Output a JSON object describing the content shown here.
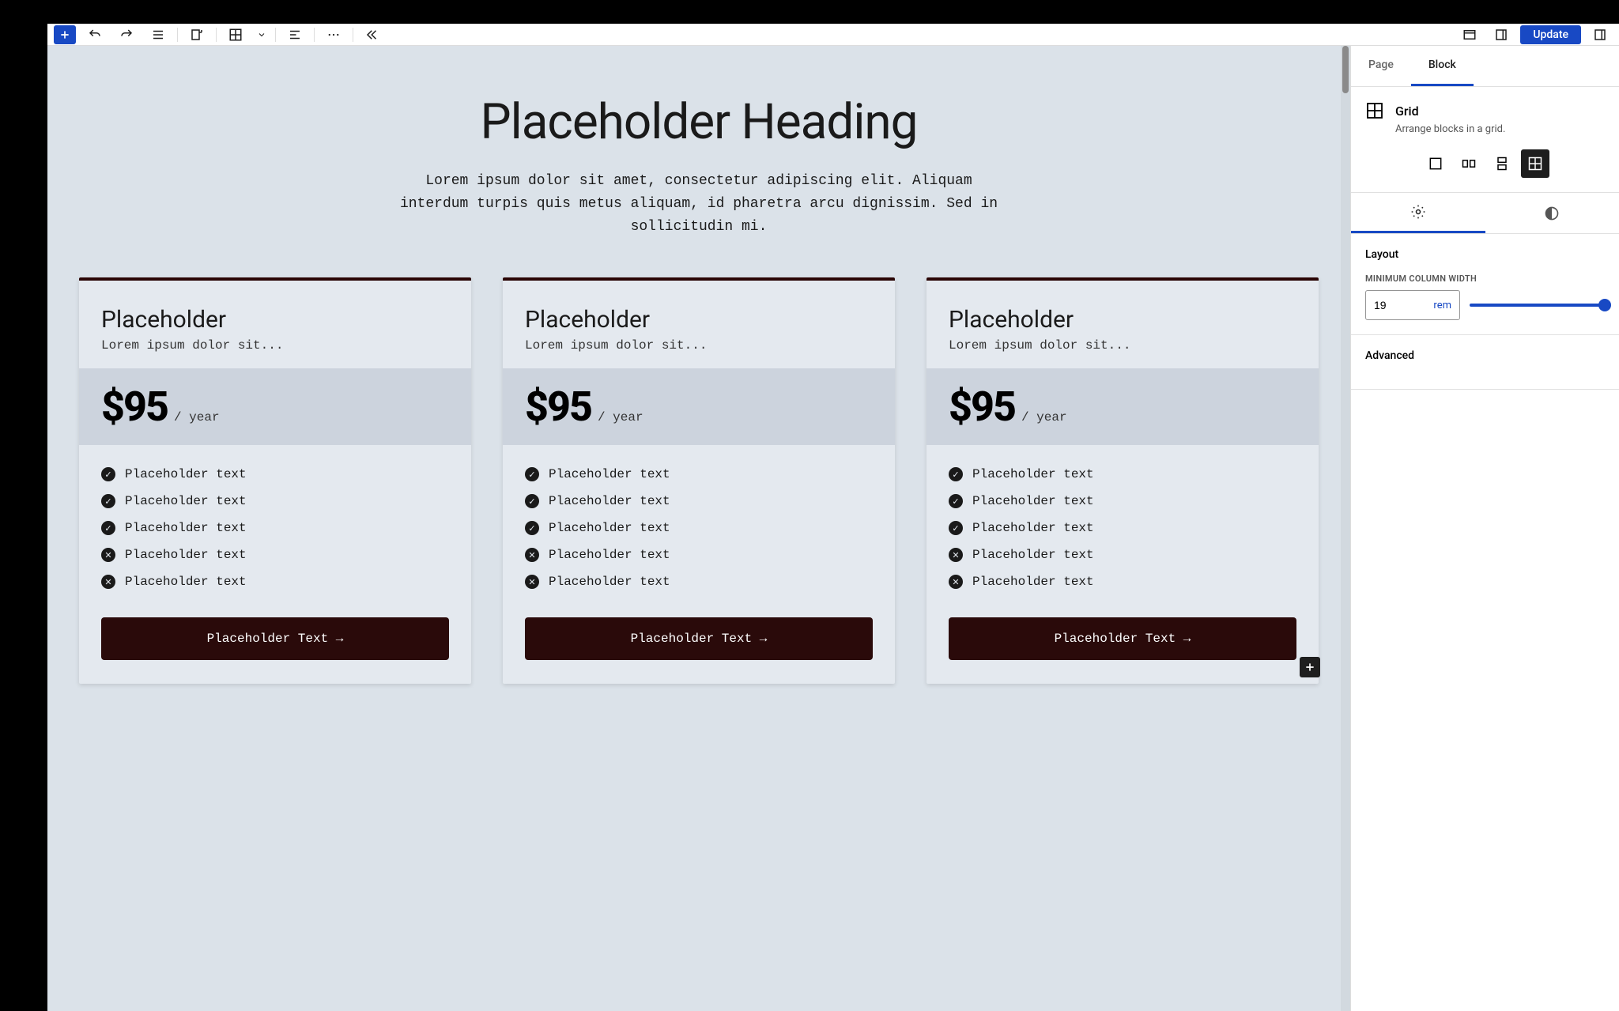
{
  "toolbar": {
    "update_label": "Update"
  },
  "sidebar": {
    "tabs": {
      "page": "Page",
      "block": "Block"
    },
    "block": {
      "name": "Grid",
      "description": "Arrange blocks in a grid."
    },
    "layout": {
      "title": "Layout",
      "min_col_width_label": "Minimum Column Width",
      "min_col_width_value": "19",
      "min_col_width_unit": "rem"
    },
    "advanced": {
      "title": "Advanced"
    }
  },
  "content": {
    "heading": "Placeholder Heading",
    "subheading": "Lorem ipsum dolor sit amet, consectetur adipiscing elit. Aliquam interdum turpis quis metus aliquam, id pharetra arcu dignissim. Sed in sollicitudin mi.",
    "cards": [
      {
        "title": "Placeholder",
        "subtitle": "Lorem ipsum dolor sit...",
        "price": "$95",
        "period": "/ year",
        "features": [
          {
            "ok": true,
            "text": "Placeholder text"
          },
          {
            "ok": true,
            "text": "Placeholder text"
          },
          {
            "ok": true,
            "text": "Placeholder text"
          },
          {
            "ok": false,
            "text": "Placeholder text"
          },
          {
            "ok": false,
            "text": "Placeholder text"
          }
        ],
        "cta": "Placeholder Text →"
      },
      {
        "title": "Placeholder",
        "subtitle": "Lorem ipsum dolor sit...",
        "price": "$95",
        "period": "/ year",
        "features": [
          {
            "ok": true,
            "text": "Placeholder text"
          },
          {
            "ok": true,
            "text": "Placeholder text"
          },
          {
            "ok": true,
            "text": "Placeholder text"
          },
          {
            "ok": false,
            "text": "Placeholder text"
          },
          {
            "ok": false,
            "text": "Placeholder text"
          }
        ],
        "cta": "Placeholder Text →"
      },
      {
        "title": "Placeholder",
        "subtitle": "Lorem ipsum dolor sit...",
        "price": "$95",
        "period": "/ year",
        "features": [
          {
            "ok": true,
            "text": "Placeholder text"
          },
          {
            "ok": true,
            "text": "Placeholder text"
          },
          {
            "ok": true,
            "text": "Placeholder text"
          },
          {
            "ok": false,
            "text": "Placeholder text"
          },
          {
            "ok": false,
            "text": "Placeholder text"
          }
        ],
        "cta": "Placeholder Text →"
      }
    ]
  }
}
